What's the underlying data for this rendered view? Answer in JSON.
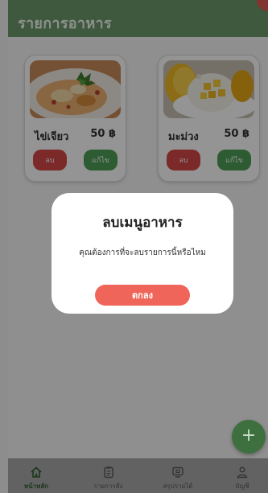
{
  "header": {
    "title": "รายการอาหาร"
  },
  "menu_items": [
    {
      "name": "ไข่เจียว",
      "price": "50 ฿",
      "delete_label": "ลบ",
      "edit_label": "แก้ไข"
    },
    {
      "name": "มะม่วง",
      "price": "50 ฿",
      "delete_label": "ลบ",
      "edit_label": "แก้ไข"
    }
  ],
  "dialog": {
    "title": "ลบเมนูอาหาร",
    "message": "คุณต้องการที่จะลบรายการนี้หรือไหม",
    "confirm_label": "ตกลง"
  },
  "fab": {
    "icon": "+"
  },
  "nav": [
    {
      "label": "หน้าหลัก",
      "icon": "home-icon",
      "active": true
    },
    {
      "label": "รายการสั่ง",
      "icon": "clipboard-icon",
      "active": false
    },
    {
      "label": "สรุปรายได้",
      "icon": "monitor-icon",
      "active": false
    },
    {
      "label": "บัญชี",
      "icon": "user-icon",
      "active": false
    }
  ],
  "colors": {
    "header": "#6c9a6c",
    "delete": "#d44848",
    "edit": "#4f9d57",
    "confirm": "#f06559",
    "fab": "#3e6f3e"
  }
}
